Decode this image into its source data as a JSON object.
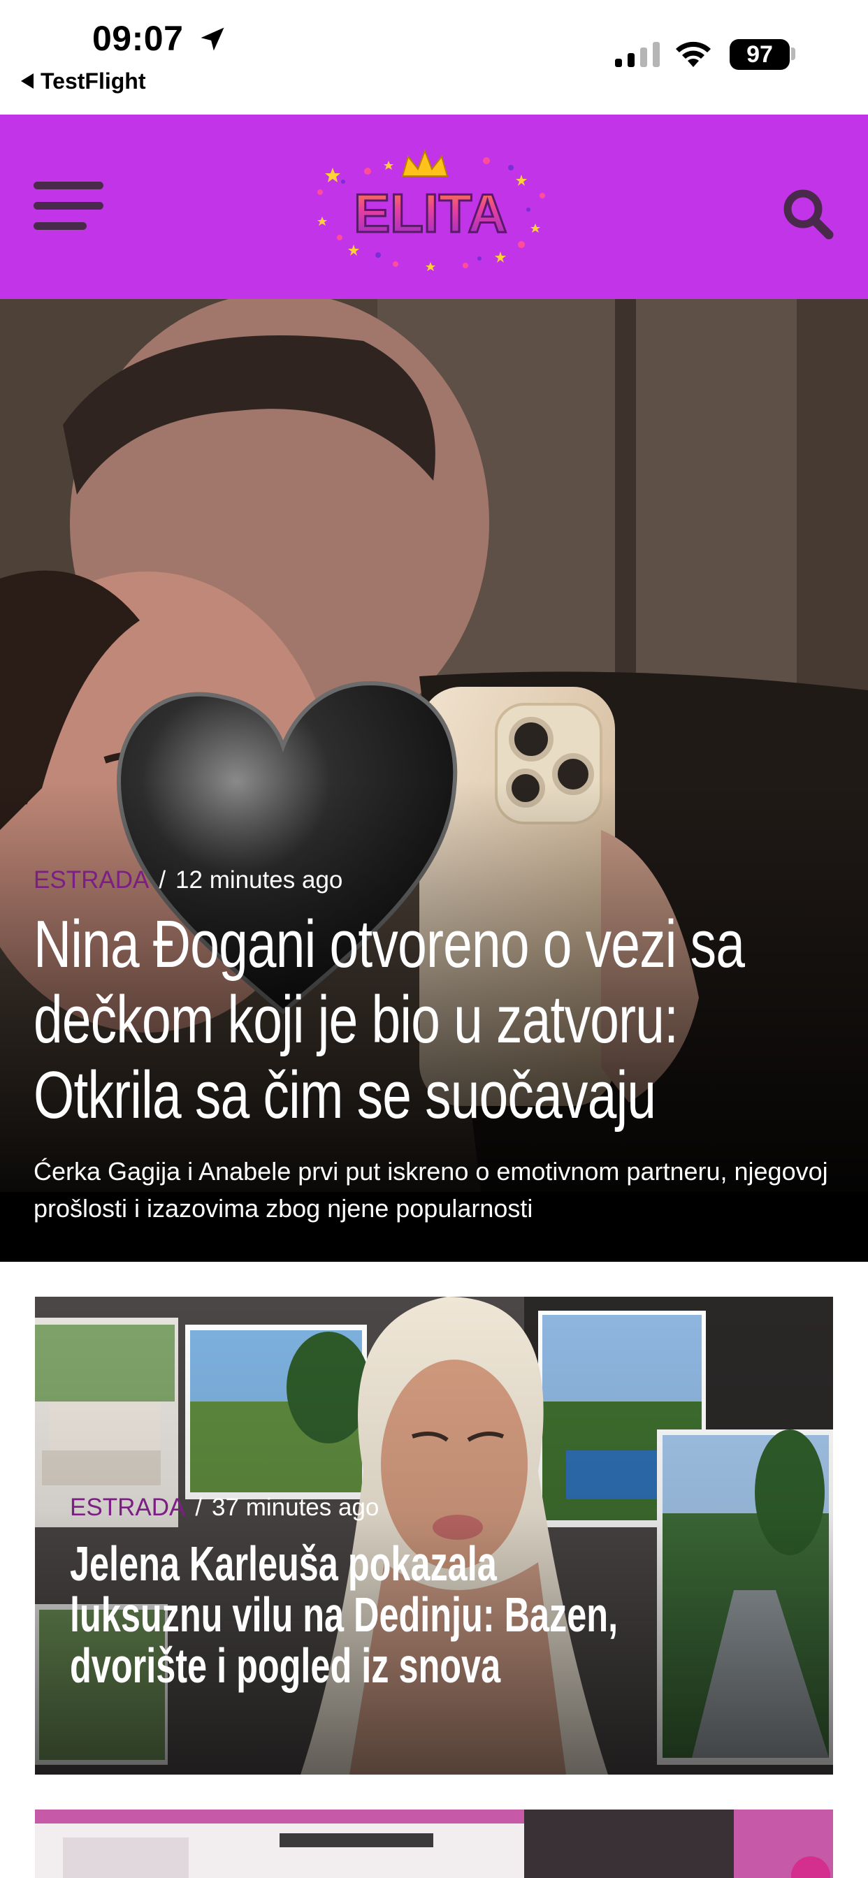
{
  "status_bar": {
    "time": "09:07",
    "back_app": "TestFlight",
    "battery": "97"
  },
  "header": {
    "logo_text": "ELITA",
    "menu_icon": "hamburger-menu-icon",
    "search_icon": "search-icon",
    "brand_color": "#c234e8"
  },
  "articles": [
    {
      "category": "ESTRADA",
      "separator": "/",
      "time_ago": "12 minutes ago",
      "title": "Nina Đogani otvoreno o vezi sa dečkom koji je bio u zatvoru: Otkrila sa čim se suočavaju",
      "excerpt": "Ćerka Gagija i Anabele prvi put iskreno o emotivnom partneru, njegovoj prošlosti i izazovima zbog njene popularnosti"
    },
    {
      "category": "ESTRADA",
      "separator": "/",
      "time_ago": "37 minutes ago",
      "title": "Jelena Karleuša pokazala luksuznu vilu na Dedinju: Bazen, dvorište i pogled iz snova"
    }
  ],
  "colors": {
    "category": "#7b1f83",
    "text_on_image": "#ffffff"
  }
}
